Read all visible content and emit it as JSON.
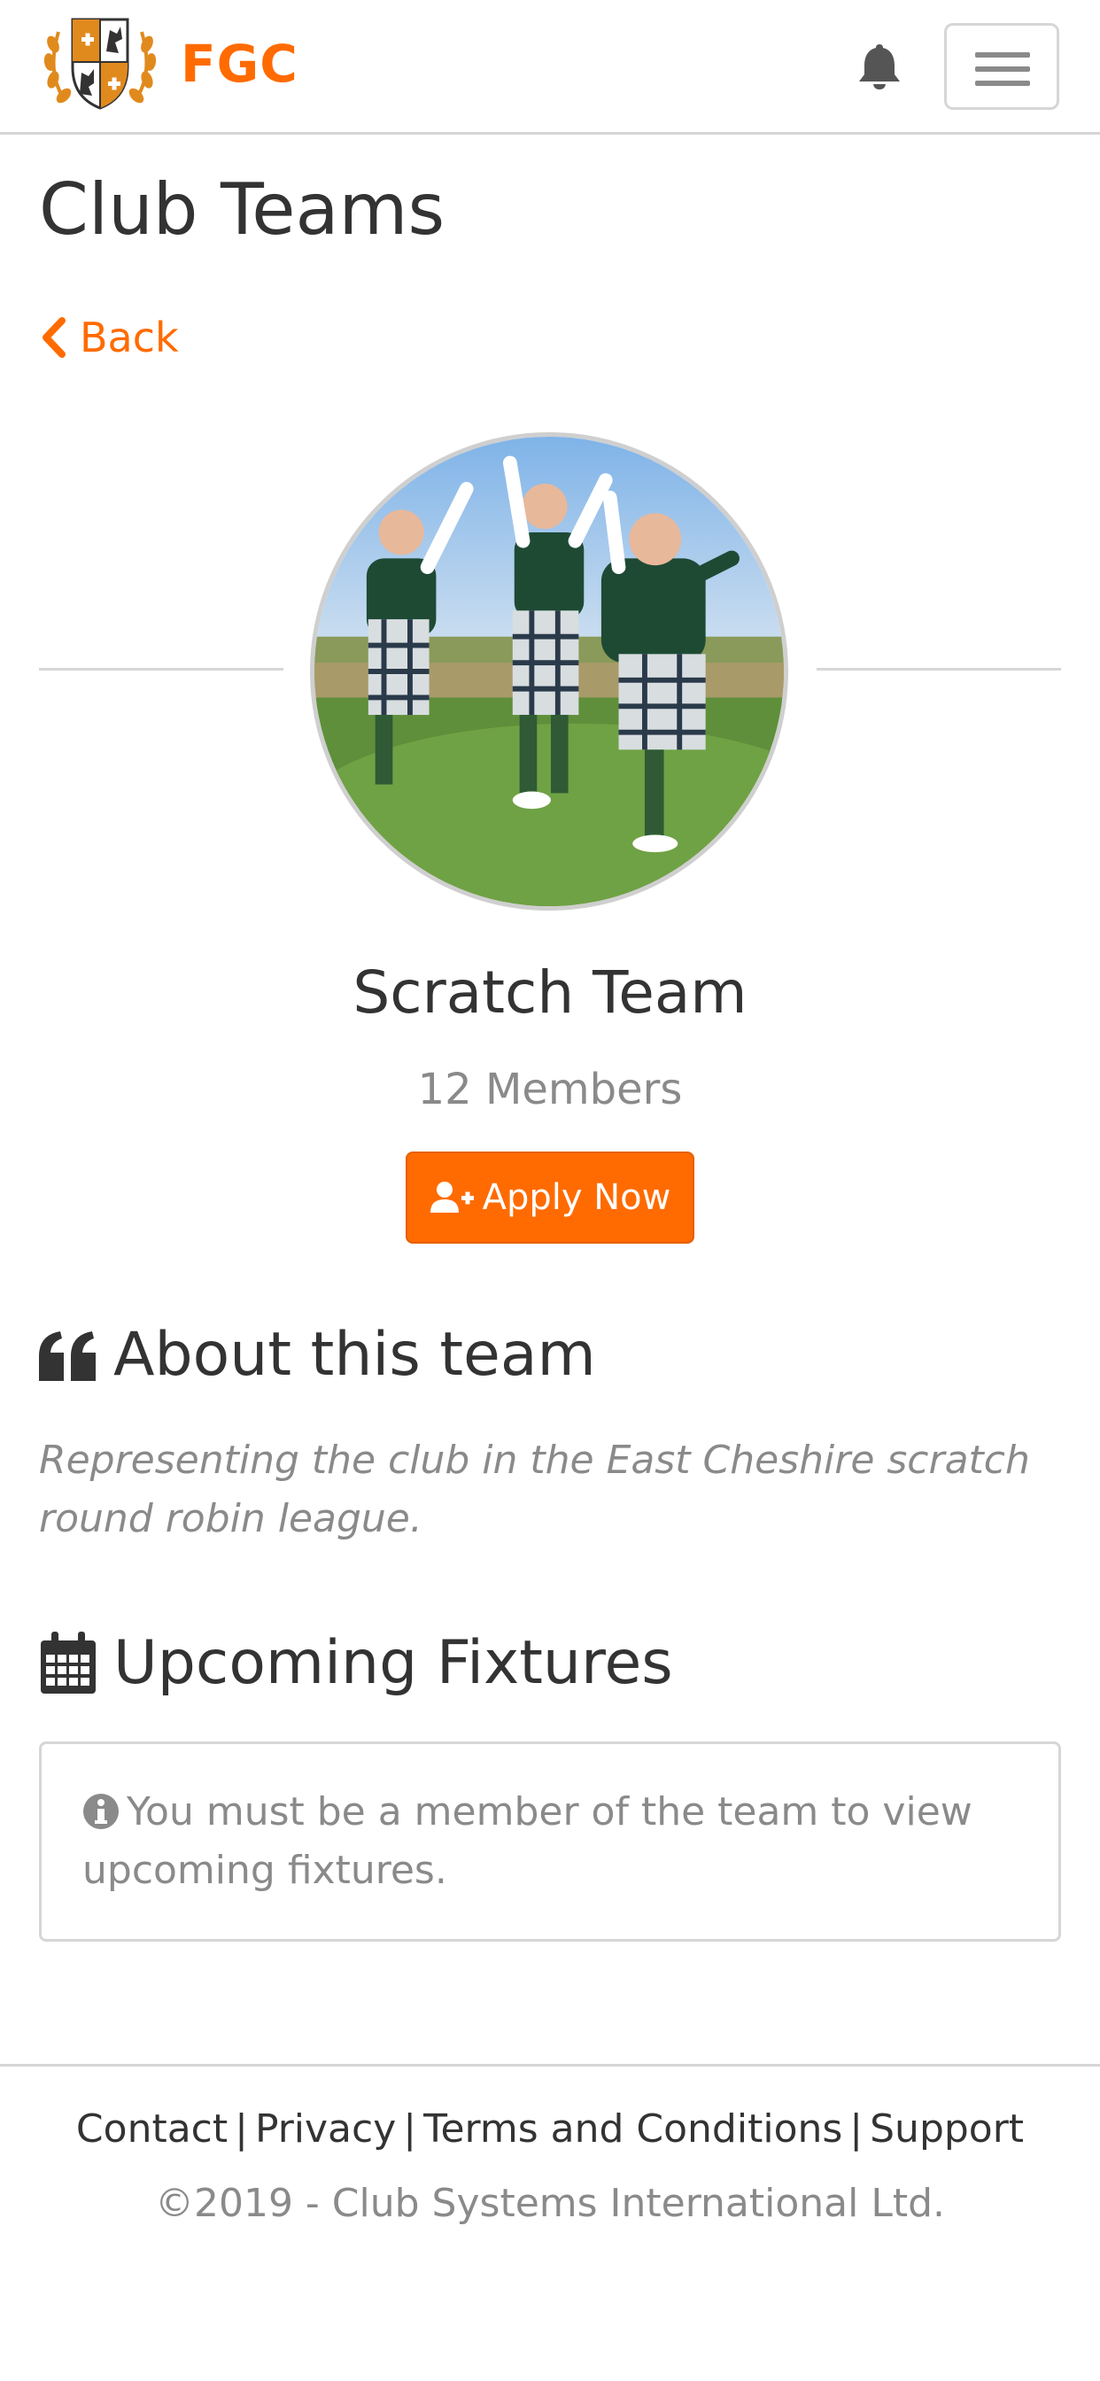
{
  "navbar": {
    "brand_name": "FGC",
    "brand_color": "#ff6b00",
    "crest_icon": "club-crest-logo",
    "notification_icon": "bell-icon",
    "menu_icon": "hamburger-menu-icon"
  },
  "header": {
    "title": "Club Teams",
    "back_label": "Back",
    "back_icon": "chevron-left-icon"
  },
  "team": {
    "name": "Scratch Team",
    "members": "12 Members",
    "apply_label": "Apply Now",
    "apply_icon": "user-plus-icon",
    "photo_description_icon": "team-photo"
  },
  "about": {
    "heading": "About this team",
    "icon": "quote-left-icon",
    "text": "Representing the club in the East Cheshire scratch round robin league."
  },
  "fixtures": {
    "heading": "Upcoming Fixtures",
    "icon": "calendar-icon",
    "notice_icon": "info-circle-icon",
    "notice": "You must be a member of the team to view upcoming fixtures."
  },
  "footer": {
    "links": [
      "Contact",
      "Privacy",
      "Terms and Conditions",
      "Support"
    ],
    "separator": "|",
    "copyright": "©2019 - Club Systems International Ltd."
  },
  "colors": {
    "accent": "#ff6b00",
    "text": "#333333",
    "muted": "#8a8a8a",
    "border": "#d6d6d6"
  }
}
